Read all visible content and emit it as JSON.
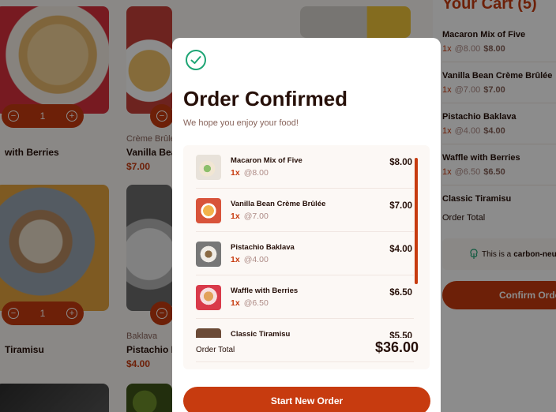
{
  "background": {
    "products": [
      {
        "category": "",
        "name": "with Berries",
        "price": "",
        "qty": "1"
      },
      {
        "category": "Crème Brûlée",
        "name": "Vanilla Bean",
        "price": "$7.00"
      },
      {
        "category": "",
        "name": "Tiramisu",
        "price": "",
        "qty": "1"
      },
      {
        "category": "Baklava",
        "name": "Pistachio B",
        "price": "$4.00"
      }
    ],
    "cart": {
      "title": "Your Cart (5)",
      "items": [
        {
          "name": "Macaron Mix of Five",
          "qty": "1x",
          "unit": "@8.00",
          "total": "$8.00"
        },
        {
          "name": "Vanilla Bean Crème Brûlée",
          "qty": "1x",
          "unit": "@7.00",
          "total": "$7.00"
        },
        {
          "name": "Pistachio Baklava",
          "qty": "1x",
          "unit": "@4.00",
          "total": "$4.00"
        },
        {
          "name": "Waffle with Berries",
          "qty": "1x",
          "unit": "@6.50",
          "total": "$6.50"
        },
        {
          "name": "Classic Tiramisu"
        }
      ],
      "order_total_label": "Order Total",
      "carbon_text": "This is a",
      "carbon_bold": "carbon-neutr",
      "confirm_label": "Confirm Orde"
    }
  },
  "modal": {
    "title": "Order Confirmed",
    "subtitle": "We hope you enjoy your food!",
    "items": [
      {
        "name": "Macaron Mix of Five",
        "qty": "1x",
        "unit": "@8.00",
        "price": "$8.00",
        "icon": "macaron-thumbnail"
      },
      {
        "name": "Vanilla Bean Crème Brûlée",
        "qty": "1x",
        "unit": "@7.00",
        "price": "$7.00",
        "icon": "creme-brulee-thumbnail"
      },
      {
        "name": "Pistachio Baklava",
        "qty": "1x",
        "unit": "@4.00",
        "price": "$4.00",
        "icon": "baklava-thumbnail"
      },
      {
        "name": "Waffle with Berries",
        "qty": "1x",
        "unit": "@6.50",
        "price": "$6.50",
        "icon": "waffle-thumbnail"
      },
      {
        "name": "Classic Tiramisu",
        "qty": "",
        "unit": "",
        "price": "$5.50",
        "icon": "tiramisu-thumbnail"
      }
    ],
    "total_label": "Order Total",
    "total_value": "$36.00",
    "button_label": "Start New Order"
  },
  "colors": {
    "accent": "#c73b0f",
    "success": "#1ea575",
    "text": "#260f08",
    "muted": "#87635a"
  }
}
